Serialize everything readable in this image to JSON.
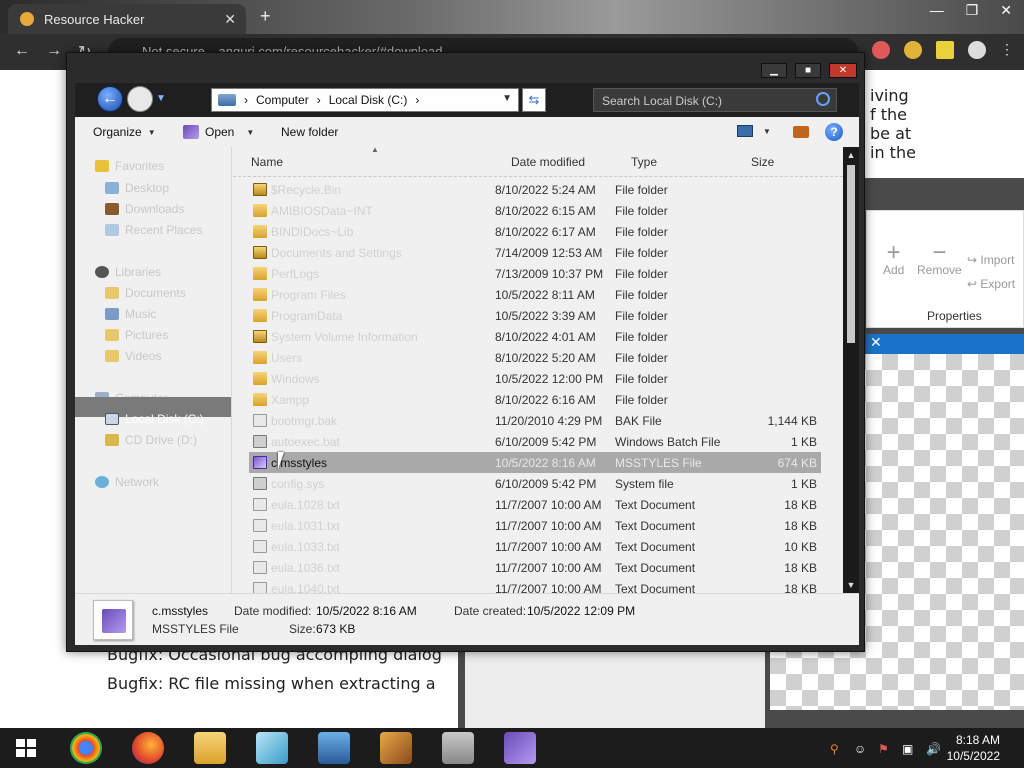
{
  "browser": {
    "tab_title": "Resource Hacker",
    "address": "anguri.com/resourcehacker/#download",
    "security": "Not secure"
  },
  "webpage": {
    "right_text": [
      "iving",
      "f the",
      "be at",
      "in the"
    ],
    "bottom_lines": [
      "Bugfix:  Occasional bug accompling dialog",
      "Bugfix:  RC file missing when extracting a"
    ],
    "properties": {
      "add": "Add",
      "remove": "Remove",
      "import": "Import",
      "export": "Export",
      "label": "Properties"
    }
  },
  "dialog": {
    "breadcrumb": [
      "Computer",
      "Local Disk (C:)"
    ],
    "search_placeholder": "Search Local Disk (C:)",
    "toolbar": {
      "organize": "Organize",
      "open": "Open",
      "new_folder": "New folder"
    },
    "nav": {
      "favorites": "Favorites",
      "desktop": "Desktop",
      "downloads": "Downloads",
      "recent": "Recent Places",
      "libraries": "Libraries",
      "documents": "Documents",
      "music": "Music",
      "pictures": "Pictures",
      "videos": "Videos",
      "computer": "Computer",
      "local_disk": "Local Disk (C:)",
      "cd_drive": "CD Drive (D:)",
      "network": "Network"
    },
    "columns": {
      "name": "Name",
      "date": "Date modified",
      "type": "Type",
      "size": "Size"
    },
    "files": [
      {
        "name": "$Recycle.Bin",
        "date": "8/10/2022 5:24 AM",
        "type": "File folder",
        "size": "",
        "icon": "lock"
      },
      {
        "name": "AMIBIOSData~INT",
        "date": "8/10/2022 6:15 AM",
        "type": "File folder",
        "size": "",
        "icon": "folder"
      },
      {
        "name": "BINDIDocs~Lib",
        "date": "8/10/2022 6:17 AM",
        "type": "File folder",
        "size": "",
        "icon": "folder"
      },
      {
        "name": "Documents and Settings",
        "date": "7/14/2009 12:53 AM",
        "type": "File folder",
        "size": "",
        "icon": "lock"
      },
      {
        "name": "PerfLogs",
        "date": "7/13/2009 10:37 PM",
        "type": "File folder",
        "size": "",
        "icon": "folder"
      },
      {
        "name": "Program Files",
        "date": "10/5/2022 8:11 AM",
        "type": "File folder",
        "size": "",
        "icon": "folder"
      },
      {
        "name": "ProgramData",
        "date": "10/5/2022 3:39 AM",
        "type": "File folder",
        "size": "",
        "icon": "folder"
      },
      {
        "name": "System Volume Information",
        "date": "8/10/2022 4:01 AM",
        "type": "File folder",
        "size": "",
        "icon": "lock"
      },
      {
        "name": "Users",
        "date": "8/10/2022 5:20 AM",
        "type": "File folder",
        "size": "",
        "icon": "folder"
      },
      {
        "name": "Windows",
        "date": "10/5/2022 12:00 PM",
        "type": "File folder",
        "size": "",
        "icon": "folder"
      },
      {
        "name": "Xampp",
        "date": "8/10/2022 6:16 AM",
        "type": "File folder",
        "size": "",
        "icon": "folder"
      },
      {
        "name": "bootmgr.bak",
        "date": "11/20/2010 4:29 PM",
        "type": "BAK File",
        "size": "1,144 KB",
        "icon": "file"
      },
      {
        "name": "autoexec.bat",
        "date": "6/10/2009 5:42 PM",
        "type": "Windows Batch File",
        "size": "1 KB",
        "icon": "bat"
      },
      {
        "name": "c.msstyles",
        "date": "10/5/2022 8:16 AM",
        "type": "MSSTYLES File",
        "size": "674 KB",
        "icon": "style",
        "selected": true
      },
      {
        "name": "config.sys",
        "date": "6/10/2009 5:42 PM",
        "type": "System file",
        "size": "1 KB",
        "icon": "bat"
      },
      {
        "name": "eula.1028.txt",
        "date": "11/7/2007 10:00 AM",
        "type": "Text Document",
        "size": "18 KB",
        "icon": "file"
      },
      {
        "name": "eula.1031.txt",
        "date": "11/7/2007 10:00 AM",
        "type": "Text Document",
        "size": "18 KB",
        "icon": "file"
      },
      {
        "name": "eula.1033.txt",
        "date": "11/7/2007 10:00 AM",
        "type": "Text Document",
        "size": "10 KB",
        "icon": "file"
      },
      {
        "name": "eula.1036.txt",
        "date": "11/7/2007 10:00 AM",
        "type": "Text Document",
        "size": "18 KB",
        "icon": "file"
      },
      {
        "name": "eula.1040.txt",
        "date": "11/7/2007 10:00 AM",
        "type": "Text Document",
        "size": "18 KB",
        "icon": "file"
      }
    ],
    "details": {
      "name": "c.msstyles",
      "type": "MSSTYLES File",
      "modified_label": "Date modified:",
      "modified": "10/5/2022 8:16 AM",
      "created_label": "Date created:",
      "created": "10/5/2022 12:09 PM",
      "size_label": "Size:",
      "size": "673 KB"
    }
  },
  "taskbar": {
    "time": "8:18 AM",
    "date": "10/5/2022"
  },
  "colors": {
    "dialog_frame": "#2b2b2b",
    "selection": "#a9a9a9",
    "taskbar": "#1c1c1c"
  }
}
